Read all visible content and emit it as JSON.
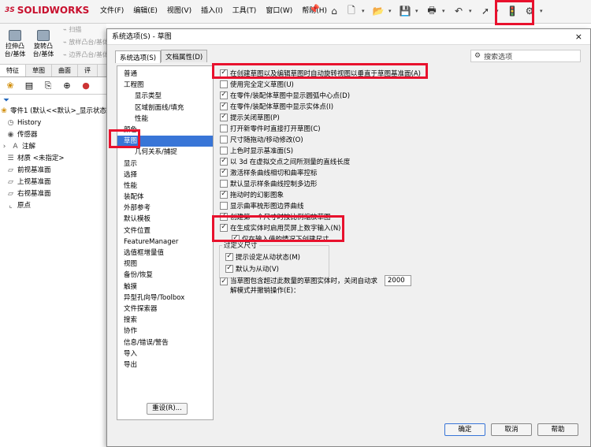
{
  "app": {
    "logo_prefix": "3S",
    "logo": "SOLIDWORKS"
  },
  "menu": [
    "文件(F)",
    "编辑(E)",
    "视图(V)",
    "插入(I)",
    "工具(T)",
    "窗口(W)",
    "帮助(H)"
  ],
  "toolbar_icons": [
    "home-icon",
    "new-file-icon",
    "open-folder-icon",
    "save-icon",
    "print-icon",
    "undo-icon",
    "select-arrow-icon",
    "traffic-light-icon",
    "options-gear-icon"
  ],
  "commands": {
    "extrude": "拉伸凸\n台/基体",
    "revolve": "旋转凸\n台/基体",
    "sweep": "扫描",
    "loft": "放样凸台/基体",
    "boundary": "边界凸台/基体"
  },
  "cm_tabs": [
    "特征",
    "草图",
    "曲面",
    "评"
  ],
  "tree": {
    "part": "零件1 (默认<<默认>_显示状态",
    "items": [
      "History",
      "传感器",
      "注解",
      "材质 <未指定>",
      "前视基准面",
      "上视基准面",
      "右视基准面",
      "原点"
    ]
  },
  "dialog": {
    "title": "系统选项(S) - 草图",
    "close": "×",
    "tab_system": "系统选项(S)",
    "tab_doc": "文档属性(D)",
    "search_placeholder": "搜索选项",
    "reset": "重设(R)...",
    "ok": "确定",
    "cancel": "取消",
    "help": "帮助"
  },
  "categories": [
    {
      "label": "普通",
      "level": 0
    },
    {
      "label": "工程图",
      "level": 0
    },
    {
      "label": "显示类型",
      "level": 1
    },
    {
      "label": "区域剖面线/填充",
      "level": 1
    },
    {
      "label": "性能",
      "level": 1
    },
    {
      "label": "颜色",
      "level": 0
    },
    {
      "label": "草图",
      "level": 0,
      "selected": true
    },
    {
      "label": "几何关系/捕捉",
      "level": 1
    },
    {
      "label": "显示",
      "level": 0
    },
    {
      "label": "选择",
      "level": 0
    },
    {
      "label": "性能",
      "level": 0
    },
    {
      "label": "装配体",
      "level": 0
    },
    {
      "label": "外部参考",
      "level": 0
    },
    {
      "label": "默认模板",
      "level": 0
    },
    {
      "label": "文件位置",
      "level": 0
    },
    {
      "label": "FeatureManager",
      "level": 0
    },
    {
      "label": "选值框增量值",
      "level": 0
    },
    {
      "label": "视图",
      "level": 0
    },
    {
      "label": "备份/恢复",
      "level": 0
    },
    {
      "label": "触摸",
      "level": 0
    },
    {
      "label": "异型孔向导/Toolbox",
      "level": 0
    },
    {
      "label": "文件探索器",
      "level": 0
    },
    {
      "label": "搜索",
      "level": 0
    },
    {
      "label": "协作",
      "level": 0
    },
    {
      "label": "信息/错误/警告",
      "level": 0
    },
    {
      "label": "导入",
      "level": 0
    },
    {
      "label": "导出",
      "level": 0
    }
  ],
  "options": [
    {
      "label": "在创建草图以及编辑草图时自动旋转视图以垂直于草图基准面(A)",
      "checked": true
    },
    {
      "label": "使用完全定义草图(U)",
      "checked": false
    },
    {
      "label": "在零件/装配体草图中显示圆弧中心点(D)",
      "checked": true
    },
    {
      "label": "在零件/装配体草图中显示实体点(I)",
      "checked": true
    },
    {
      "label": "提示关闭草图(P)",
      "checked": true
    },
    {
      "label": "打开新零件时直接打开草图(C)",
      "checked": false
    },
    {
      "label": "尺寸随拖动/移动修改(O)",
      "checked": false
    },
    {
      "label": "上色时显示基准面(S)",
      "checked": false
    },
    {
      "label": "以 3d 在虚拟交点之间所测量的直线长度",
      "checked": true
    },
    {
      "label": "激活样条曲线相切和曲率控标",
      "checked": true
    },
    {
      "label": "默认显示样条曲线控制多边形",
      "checked": false
    },
    {
      "label": "拖动时的幻影图象",
      "checked": true
    },
    {
      "label": "显示曲率梳形图边界曲线",
      "checked": false
    },
    {
      "label": "创建第一个尺寸时按比例缩放草图",
      "checked": true
    },
    {
      "label": "在生成实体时启用荧屏上数字输入(N)",
      "checked": true
    },
    {
      "label": "仅在输入值的情况下创建尺寸",
      "checked": true
    }
  ],
  "overdefine": {
    "label": "过定义尺寸",
    "items": [
      {
        "label": "提示设定从动状态(M)",
        "checked": true
      },
      {
        "label": "默认为从动(V)",
        "checked": true
      }
    ]
  },
  "undo_option": {
    "label1": "当草图包含超过此数量的草图实体时，关闭自动求",
    "label2": "解模式并撤销操作(E)：",
    "value": "2000",
    "checked": true
  }
}
